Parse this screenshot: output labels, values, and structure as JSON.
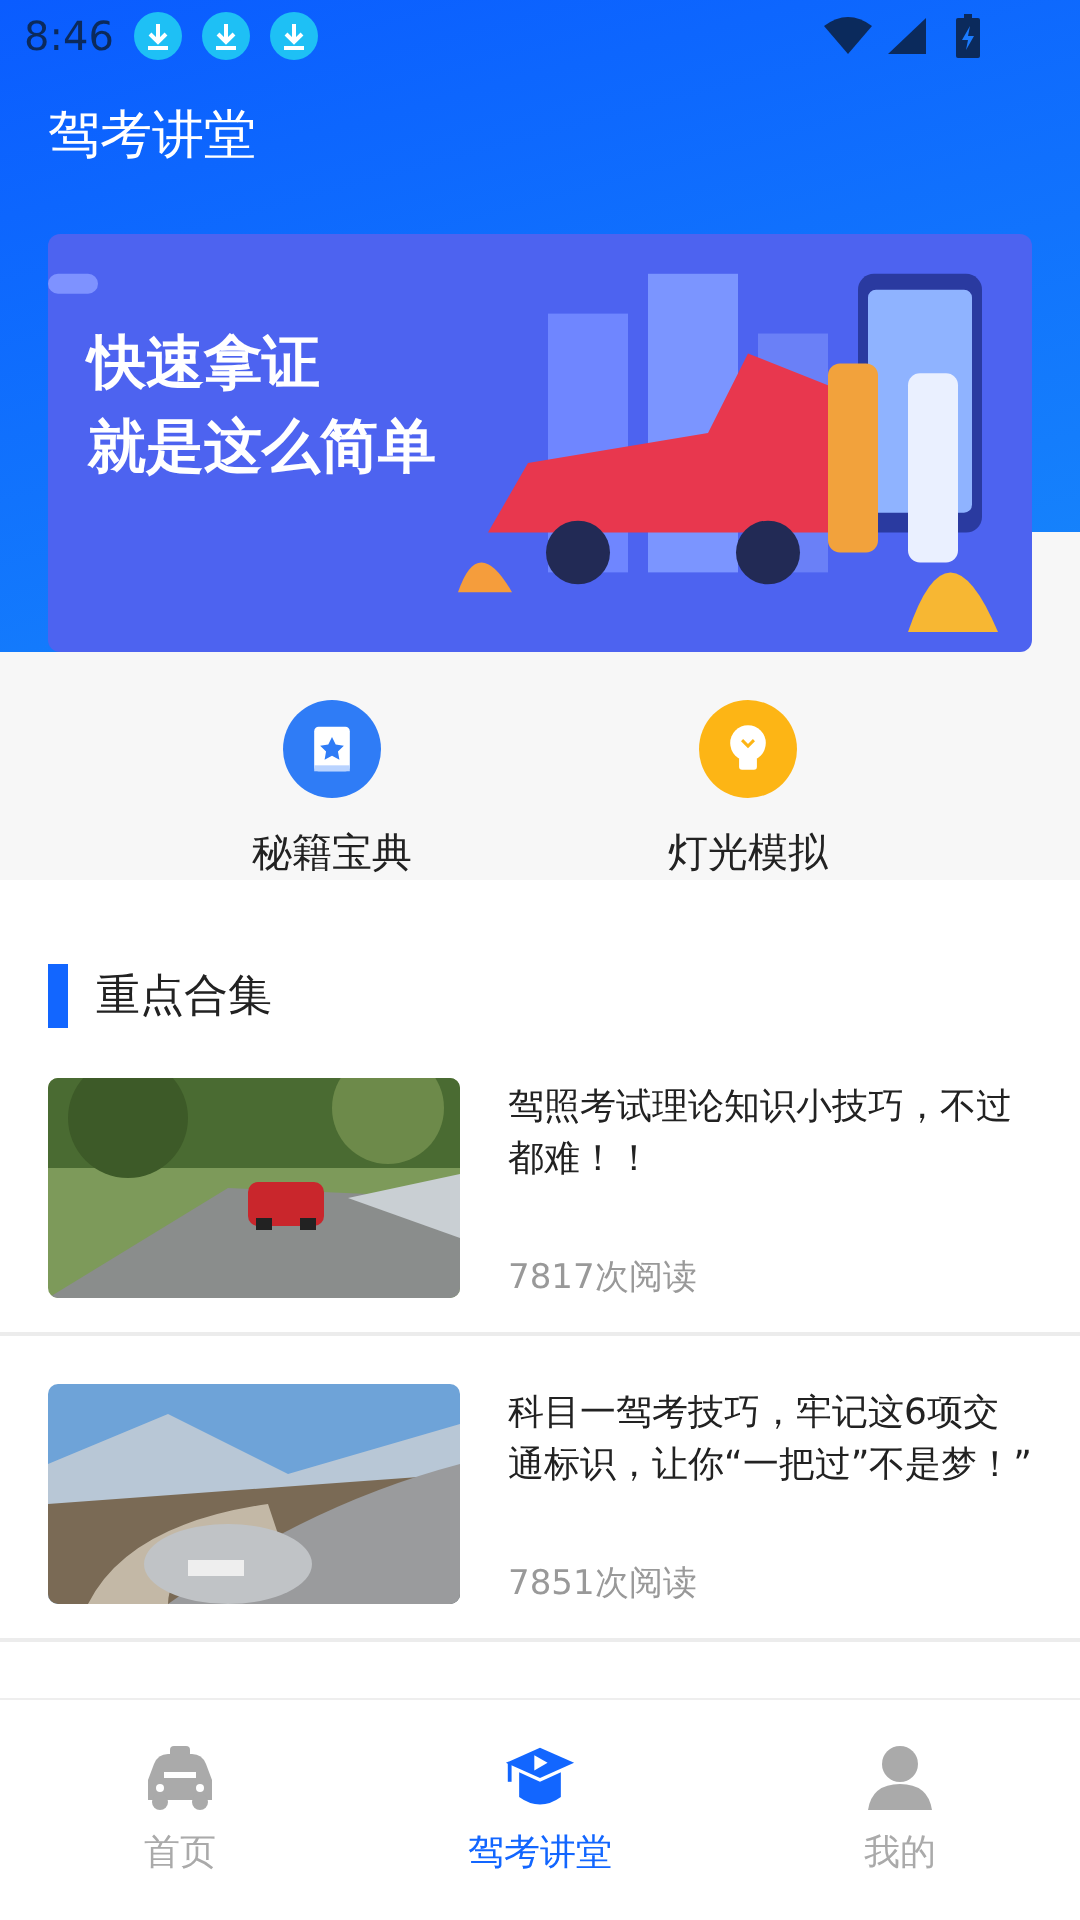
{
  "status_bar": {
    "time": "8:46",
    "notifications": [
      {
        "kind": "download"
      },
      {
        "kind": "download"
      },
      {
        "kind": "download"
      }
    ]
  },
  "header": {
    "title": "驾考讲堂"
  },
  "banner": {
    "kind": "picture",
    "lines": [
      "快速拿证",
      "就是这么简单"
    ]
  },
  "shortcuts": [
    {
      "label": "秘籍宝典",
      "kind": "book"
    },
    {
      "label": "灯光模拟",
      "kind": "bulb"
    }
  ],
  "section": {
    "title": "重点合集"
  },
  "articles": [
    {
      "title": "驾照考试理论知识小技巧，不过都难！！",
      "reads": "7817次阅读"
    },
    {
      "title": "科目一驾考技巧，牢记这6项交通标识，让你“一把过”不是梦！”",
      "reads": "7851次阅读"
    }
  ],
  "tabs": [
    {
      "label": "首页",
      "kind": "car",
      "selected": false
    },
    {
      "label": "驾考讲堂",
      "kind": "cap",
      "selected": true
    },
    {
      "label": "我的",
      "kind": "person",
      "selected": false
    }
  ]
}
